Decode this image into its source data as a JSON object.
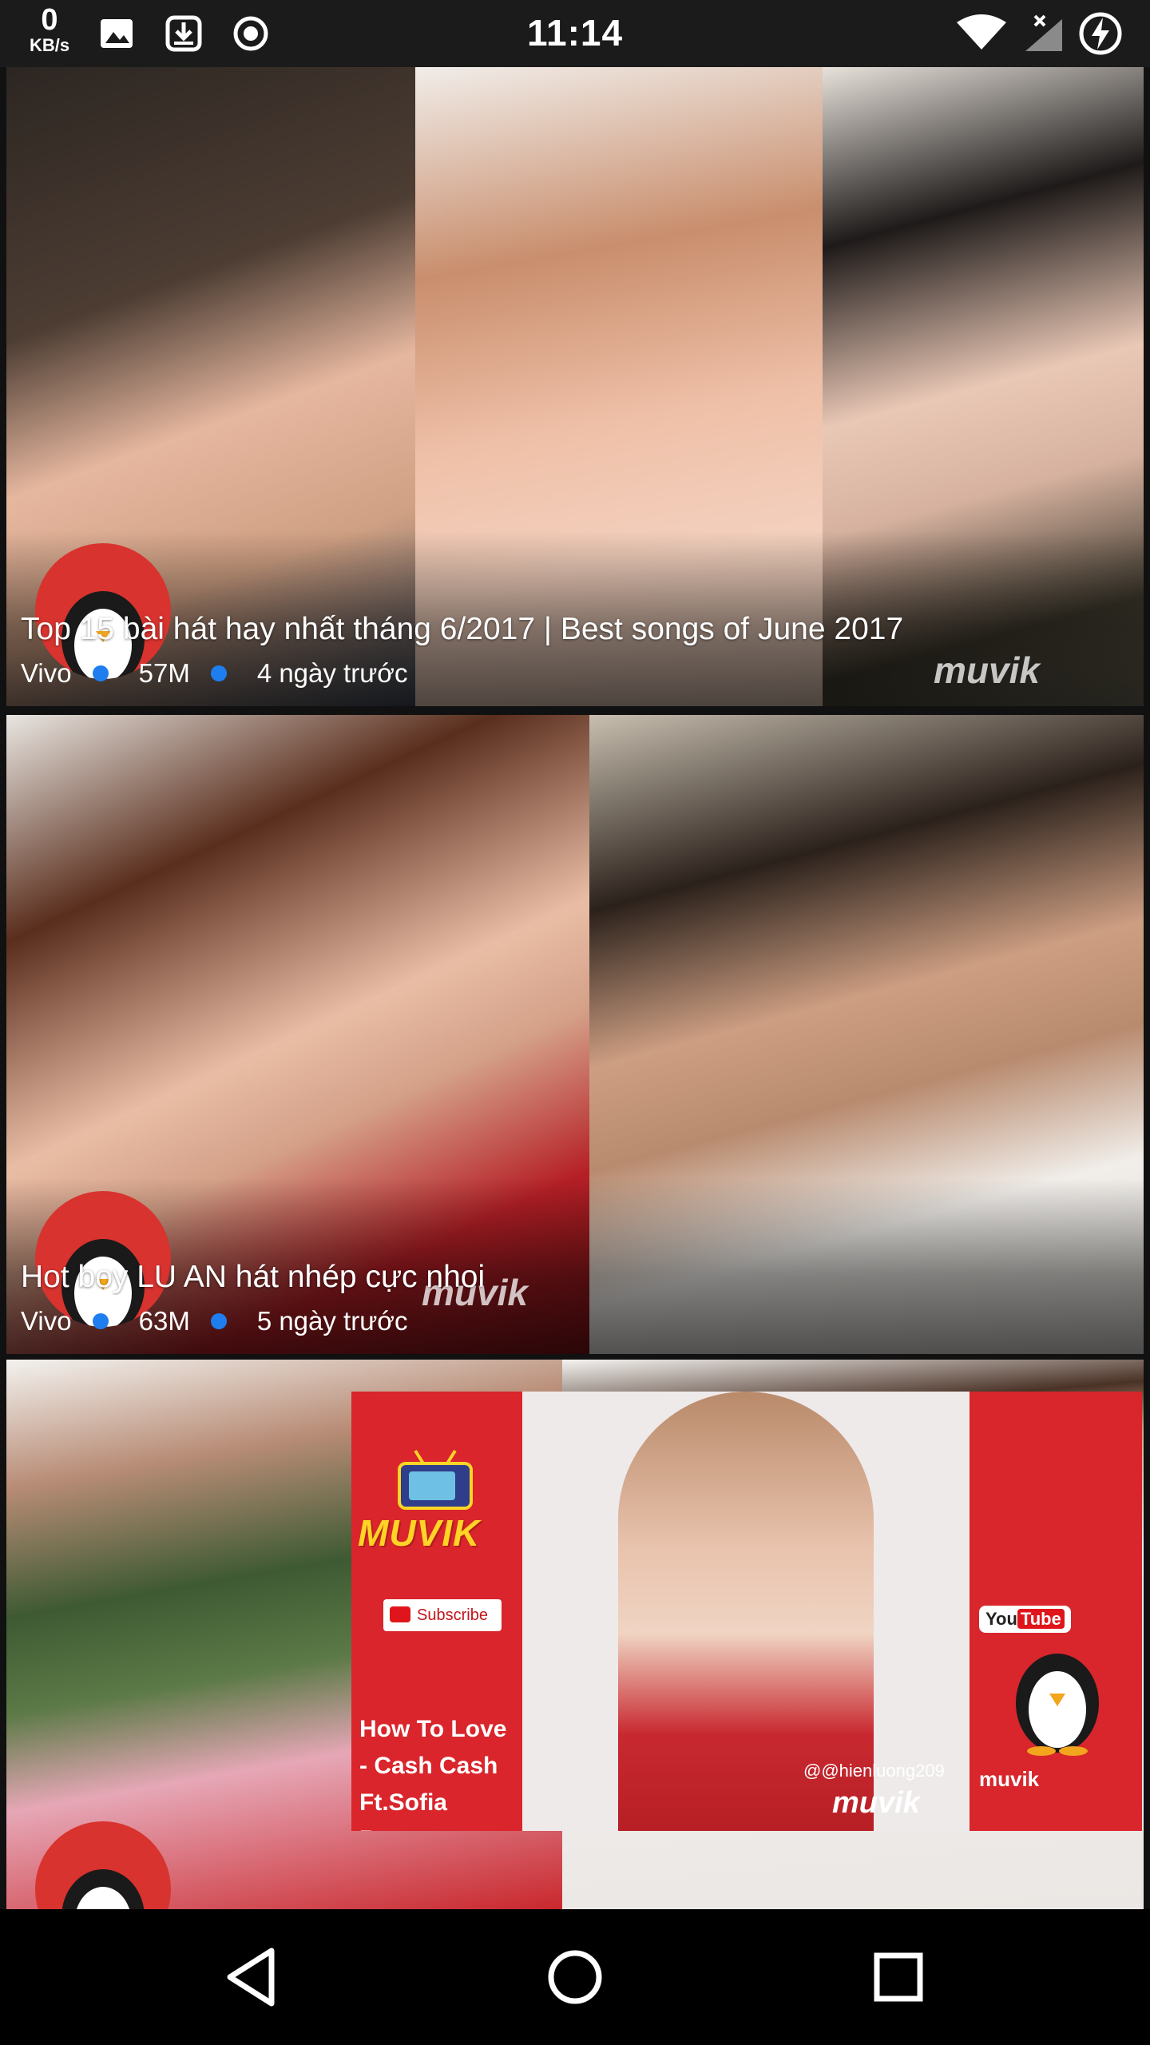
{
  "status_bar": {
    "net_speed": "0",
    "net_unit": "KB/s",
    "time": "11:14",
    "icons": [
      "image-icon",
      "download-icon",
      "record-icon",
      "wifi-icon",
      "no-signal-icon",
      "battery-charging-icon"
    ]
  },
  "feed": {
    "items": [
      {
        "title": "Top 15 bài hát hay nhất tháng 6/2017 | Best songs of June 2017",
        "channel": "Vivo",
        "views": "57M",
        "age": "4 ngày trước"
      },
      {
        "title": "Hot boy LU AN hát nhép cực nhoi",
        "channel": "Vivo",
        "views": "63M",
        "age": "5 ngày trước"
      }
    ],
    "watermark": "muvik"
  },
  "ad": {
    "brand": "MUVIK",
    "subscribe": "Subscribe",
    "song": "How To Love - Cash Cash Ft.Sofia Reyes",
    "handle": "@@hienluong209",
    "mark": "muvik",
    "youtube_badge_you": "You",
    "youtube_badge_tube": "Tube",
    "right_brand": "muvik"
  },
  "colors": {
    "accent_dot": "#1e7ef0",
    "ad_red": "#d9252b",
    "muvik_yellow": "#ffd426"
  },
  "navbar": {
    "buttons": [
      "back-button",
      "home-button",
      "recents-button"
    ]
  }
}
